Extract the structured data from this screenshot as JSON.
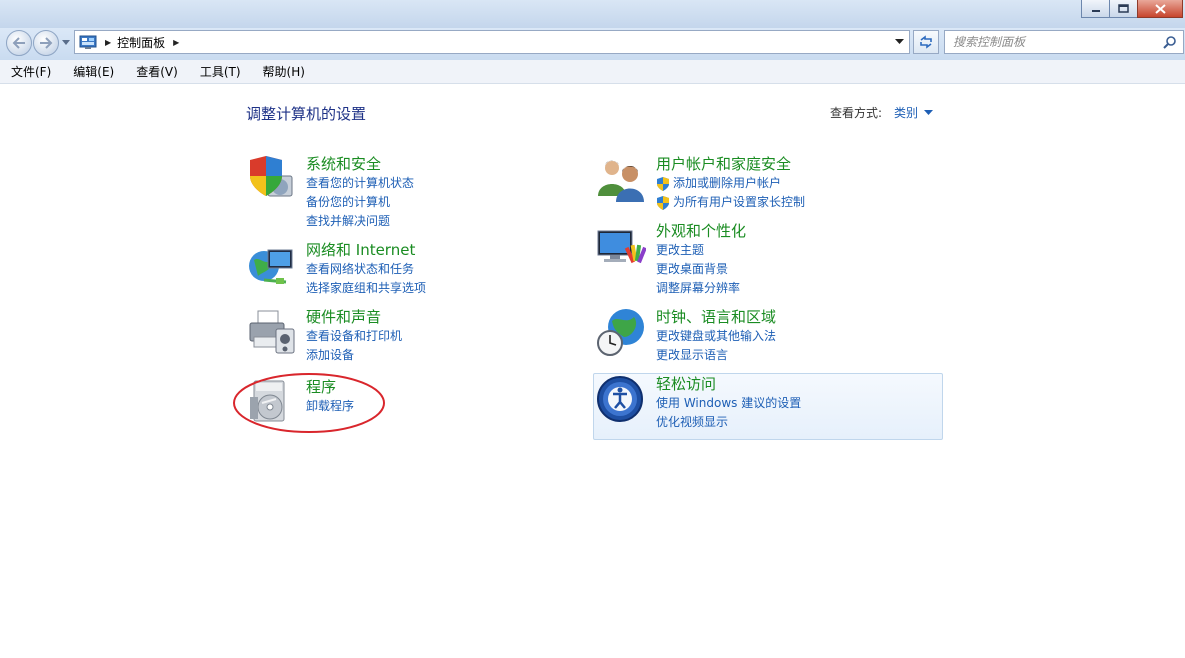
{
  "window": {
    "min_icon": "minimize-icon",
    "max_icon": "maximize-icon",
    "close_icon": "close-icon"
  },
  "nav": {
    "breadcrumb": "控制面板",
    "search_placeholder": "搜索控制面板"
  },
  "menu": [
    "文件(F)",
    "编辑(E)",
    "查看(V)",
    "工具(T)",
    "帮助(H)"
  ],
  "main": {
    "title": "调整计算机的设置",
    "view_by_label": "查看方式:",
    "view_by_value": "类别"
  },
  "categories": [
    {
      "title": "系统和安全",
      "icon": "shield-computer-icon",
      "links": [
        "查看您的计算机状态",
        "备份您的计算机",
        "查找并解决问题"
      ]
    },
    {
      "title": "网络和 Internet",
      "icon": "globe-network-icon",
      "links": [
        "查看网络状态和任务",
        "选择家庭组和共享选项"
      ]
    },
    {
      "title": "硬件和声音",
      "icon": "printer-icon",
      "links": [
        "查看设备和打印机",
        "添加设备"
      ]
    },
    {
      "title": "程序",
      "icon": "programs-disc-icon",
      "links": [
        "卸载程序"
      ]
    },
    {
      "title": "用户帐户和家庭安全",
      "icon": "users-icon",
      "links": [
        "添加或删除用户帐户",
        "为所有用户设置家长控制"
      ]
    },
    {
      "title": "外观和个性化",
      "icon": "monitor-paint-icon",
      "links": [
        "更改主题",
        "更改桌面背景",
        "调整屏幕分辨率"
      ]
    },
    {
      "title": "时钟、语言和区域",
      "icon": "clock-globe-icon",
      "links": [
        "更改键盘或其他输入法",
        "更改显示语言"
      ]
    },
    {
      "title": "轻松访问",
      "icon": "ease-of-access-icon",
      "links": [
        "使用 Windows 建议的设置",
        "优化视频显示"
      ]
    }
  ],
  "colors": {
    "category_title": "#1a8c22",
    "link": "#1e5fb5",
    "page_title": "#1e3287",
    "annotation": "#d9262c"
  }
}
